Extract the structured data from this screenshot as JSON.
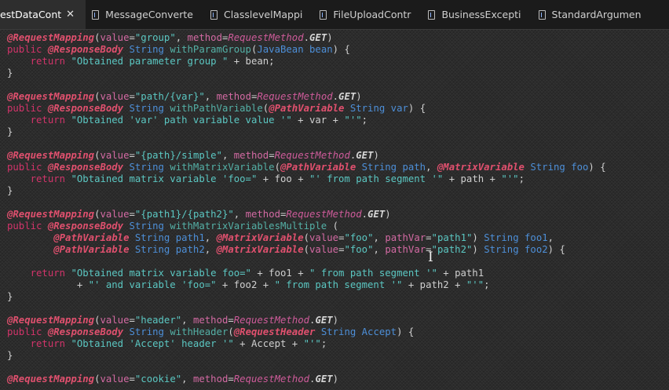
{
  "tabs": [
    {
      "label": "estDataCont",
      "active": true,
      "closable": true
    },
    {
      "label": "MessageConverte",
      "active": false
    },
    {
      "label": "ClasslevelMappi",
      "active": false
    },
    {
      "label": "FileUploadContr",
      "active": false
    },
    {
      "label": "BusinessExcepti",
      "active": false
    },
    {
      "label": "StandardArgumen",
      "active": false
    }
  ],
  "tab_close_glyph": "✕",
  "cursor_glyph": "I",
  "colors": {
    "annotation": "#e0506e",
    "keyword": "#d2346a",
    "type": "#4d8fd8",
    "method": "#54b0a6",
    "string": "#5bc7c2",
    "attribute": "#d36aa3",
    "background": "#2a2a2a"
  },
  "code_lines": [
    [
      [
        "ann",
        "@RequestMapping"
      ],
      [
        "plain",
        "("
      ],
      [
        "attr",
        "value"
      ],
      [
        "plain",
        "="
      ],
      [
        "str",
        "\"group\""
      ],
      [
        "plain",
        ", "
      ],
      [
        "attr",
        "method"
      ],
      [
        "plain",
        "="
      ],
      [
        "enum",
        "RequestMethod"
      ],
      [
        "plain",
        "."
      ],
      [
        "field",
        "GET"
      ],
      [
        "plain",
        ")"
      ]
    ],
    [
      [
        "kw",
        "public"
      ],
      [
        "plain",
        " "
      ],
      [
        "ann",
        "@ResponseBody"
      ],
      [
        "plain",
        " "
      ],
      [
        "type",
        "String"
      ],
      [
        "plain",
        " "
      ],
      [
        "method",
        "withParamGroup"
      ],
      [
        "plain",
        "("
      ],
      [
        "type",
        "JavaBean"
      ],
      [
        "plain",
        " "
      ],
      [
        "param",
        "bean"
      ],
      [
        "plain",
        ") {"
      ]
    ],
    [
      [
        "plain",
        "    "
      ],
      [
        "kw",
        "return"
      ],
      [
        "plain",
        " "
      ],
      [
        "str",
        "\"Obtained parameter group \""
      ],
      [
        "plain",
        " + bean;"
      ]
    ],
    [
      [
        "plain",
        "}"
      ]
    ],
    [],
    [
      [
        "ann",
        "@RequestMapping"
      ],
      [
        "plain",
        "("
      ],
      [
        "attr",
        "value"
      ],
      [
        "plain",
        "="
      ],
      [
        "str",
        "\"path/{var}\""
      ],
      [
        "plain",
        ", "
      ],
      [
        "attr",
        "method"
      ],
      [
        "plain",
        "="
      ],
      [
        "enum",
        "RequestMethod"
      ],
      [
        "plain",
        "."
      ],
      [
        "field",
        "GET"
      ],
      [
        "plain",
        ")"
      ]
    ],
    [
      [
        "kw",
        "public"
      ],
      [
        "plain",
        " "
      ],
      [
        "ann",
        "@ResponseBody"
      ],
      [
        "plain",
        " "
      ],
      [
        "type",
        "String"
      ],
      [
        "plain",
        " "
      ],
      [
        "method",
        "withPathVariable"
      ],
      [
        "plain",
        "("
      ],
      [
        "ann",
        "@PathVariable"
      ],
      [
        "plain",
        " "
      ],
      [
        "type",
        "String"
      ],
      [
        "plain",
        " "
      ],
      [
        "param",
        "var"
      ],
      [
        "plain",
        ") {"
      ]
    ],
    [
      [
        "plain",
        "    "
      ],
      [
        "kw",
        "return"
      ],
      [
        "plain",
        " "
      ],
      [
        "str",
        "\"Obtained 'var' path variable value '\""
      ],
      [
        "plain",
        " + var + "
      ],
      [
        "str",
        "\"'\""
      ],
      [
        "plain",
        ";"
      ]
    ],
    [
      [
        "plain",
        "}"
      ]
    ],
    [],
    [
      [
        "ann",
        "@RequestMapping"
      ],
      [
        "plain",
        "("
      ],
      [
        "attr",
        "value"
      ],
      [
        "plain",
        "="
      ],
      [
        "str",
        "\"{path}/simple\""
      ],
      [
        "plain",
        ", "
      ],
      [
        "attr",
        "method"
      ],
      [
        "plain",
        "="
      ],
      [
        "enum",
        "RequestMethod"
      ],
      [
        "plain",
        "."
      ],
      [
        "field",
        "GET"
      ],
      [
        "plain",
        ")"
      ]
    ],
    [
      [
        "kw",
        "public"
      ],
      [
        "plain",
        " "
      ],
      [
        "ann",
        "@ResponseBody"
      ],
      [
        "plain",
        " "
      ],
      [
        "type",
        "String"
      ],
      [
        "plain",
        " "
      ],
      [
        "method",
        "withMatrixVariable"
      ],
      [
        "plain",
        "("
      ],
      [
        "ann",
        "@PathVariable"
      ],
      [
        "plain",
        " "
      ],
      [
        "type",
        "String"
      ],
      [
        "plain",
        " "
      ],
      [
        "param",
        "path"
      ],
      [
        "plain",
        ", "
      ],
      [
        "ann",
        "@MatrixVariable"
      ],
      [
        "plain",
        " "
      ],
      [
        "type",
        "String"
      ],
      [
        "plain",
        " "
      ],
      [
        "param",
        "foo"
      ],
      [
        "plain",
        ") {"
      ]
    ],
    [
      [
        "plain",
        "    "
      ],
      [
        "kw",
        "return"
      ],
      [
        "plain",
        " "
      ],
      [
        "str",
        "\"Obtained matrix variable 'foo=\""
      ],
      [
        "plain",
        " + foo + "
      ],
      [
        "str",
        "\"' from path segment '\""
      ],
      [
        "plain",
        " + path + "
      ],
      [
        "str",
        "\"'\""
      ],
      [
        "plain",
        ";"
      ]
    ],
    [
      [
        "plain",
        "}"
      ]
    ],
    [],
    [
      [
        "ann",
        "@RequestMapping"
      ],
      [
        "plain",
        "("
      ],
      [
        "attr",
        "value"
      ],
      [
        "plain",
        "="
      ],
      [
        "str",
        "\"{path1}/{path2}\""
      ],
      [
        "plain",
        ", "
      ],
      [
        "attr",
        "method"
      ],
      [
        "plain",
        "="
      ],
      [
        "enum",
        "RequestMethod"
      ],
      [
        "plain",
        "."
      ],
      [
        "field",
        "GET"
      ],
      [
        "plain",
        ")"
      ]
    ],
    [
      [
        "kw",
        "public"
      ],
      [
        "plain",
        " "
      ],
      [
        "ann",
        "@ResponseBody"
      ],
      [
        "plain",
        " "
      ],
      [
        "type",
        "String"
      ],
      [
        "plain",
        " "
      ],
      [
        "method",
        "withMatrixVariablesMultiple"
      ],
      [
        "plain",
        " ("
      ]
    ],
    [
      [
        "plain",
        "        "
      ],
      [
        "ann",
        "@PathVariable"
      ],
      [
        "plain",
        " "
      ],
      [
        "type",
        "String"
      ],
      [
        "plain",
        " "
      ],
      [
        "param",
        "path1"
      ],
      [
        "plain",
        ", "
      ],
      [
        "ann",
        "@MatrixVariable"
      ],
      [
        "plain",
        "("
      ],
      [
        "attr",
        "value"
      ],
      [
        "plain",
        "="
      ],
      [
        "str",
        "\"foo\""
      ],
      [
        "plain",
        ", "
      ],
      [
        "attr",
        "pathVar"
      ],
      [
        "plain",
        "="
      ],
      [
        "str",
        "\"path1\""
      ],
      [
        "plain",
        ") "
      ],
      [
        "type",
        "String"
      ],
      [
        "plain",
        " "
      ],
      [
        "param",
        "foo1"
      ],
      [
        "plain",
        ","
      ]
    ],
    [
      [
        "plain",
        "        "
      ],
      [
        "ann",
        "@PathVariable"
      ],
      [
        "plain",
        " "
      ],
      [
        "type",
        "String"
      ],
      [
        "plain",
        " "
      ],
      [
        "param",
        "path2"
      ],
      [
        "plain",
        ", "
      ],
      [
        "ann",
        "@MatrixVariable"
      ],
      [
        "plain",
        "("
      ],
      [
        "attr",
        "value"
      ],
      [
        "plain",
        "="
      ],
      [
        "str",
        "\"foo\""
      ],
      [
        "plain",
        ", "
      ],
      [
        "attr",
        "pathVar"
      ],
      [
        "plain",
        "="
      ],
      [
        "str",
        "\"path2\""
      ],
      [
        "plain",
        ") "
      ],
      [
        "type",
        "String"
      ],
      [
        "plain",
        " "
      ],
      [
        "param",
        "foo2"
      ],
      [
        "plain",
        ") {"
      ]
    ],
    [],
    [
      [
        "plain",
        "    "
      ],
      [
        "kw",
        "return"
      ],
      [
        "plain",
        " "
      ],
      [
        "str",
        "\"Obtained matrix variable foo=\""
      ],
      [
        "plain",
        " + foo1 + "
      ],
      [
        "str",
        "\" from path segment '\""
      ],
      [
        "plain",
        " + path1"
      ]
    ],
    [
      [
        "plain",
        "            + "
      ],
      [
        "str",
        "\"' and variable 'foo=\""
      ],
      [
        "plain",
        " + foo2 + "
      ],
      [
        "str",
        "\" from path segment '\""
      ],
      [
        "plain",
        " + path2 + "
      ],
      [
        "str",
        "\"'\""
      ],
      [
        "plain",
        ";"
      ]
    ],
    [
      [
        "plain",
        "}"
      ]
    ],
    [],
    [
      [
        "ann",
        "@RequestMapping"
      ],
      [
        "plain",
        "("
      ],
      [
        "attr",
        "value"
      ],
      [
        "plain",
        "="
      ],
      [
        "str",
        "\"header\""
      ],
      [
        "plain",
        ", "
      ],
      [
        "attr",
        "method"
      ],
      [
        "plain",
        "="
      ],
      [
        "enum",
        "RequestMethod"
      ],
      [
        "plain",
        "."
      ],
      [
        "field",
        "GET"
      ],
      [
        "plain",
        ")"
      ]
    ],
    [
      [
        "kw",
        "public"
      ],
      [
        "plain",
        " "
      ],
      [
        "ann",
        "@ResponseBody"
      ],
      [
        "plain",
        " "
      ],
      [
        "type",
        "String"
      ],
      [
        "plain",
        " "
      ],
      [
        "method",
        "withHeader"
      ],
      [
        "plain",
        "("
      ],
      [
        "ann",
        "@RequestHeader"
      ],
      [
        "plain",
        " "
      ],
      [
        "type",
        "String"
      ],
      [
        "plain",
        " "
      ],
      [
        "param",
        "Accept"
      ],
      [
        "plain",
        ") {"
      ]
    ],
    [
      [
        "plain",
        "    "
      ],
      [
        "kw",
        "return"
      ],
      [
        "plain",
        " "
      ],
      [
        "str",
        "\"Obtained 'Accept' header '\""
      ],
      [
        "plain",
        " + Accept + "
      ],
      [
        "str",
        "\"'\""
      ],
      [
        "plain",
        ";"
      ]
    ],
    [
      [
        "plain",
        "}"
      ]
    ],
    [],
    [
      [
        "ann",
        "@RequestMapping"
      ],
      [
        "plain",
        "("
      ],
      [
        "attr",
        "value"
      ],
      [
        "plain",
        "="
      ],
      [
        "str",
        "\"cookie\""
      ],
      [
        "plain",
        ", "
      ],
      [
        "attr",
        "method"
      ],
      [
        "plain",
        "="
      ],
      [
        "enum",
        "RequestMethod"
      ],
      [
        "plain",
        "."
      ],
      [
        "field",
        "GET"
      ],
      [
        "plain",
        ")"
      ]
    ]
  ]
}
